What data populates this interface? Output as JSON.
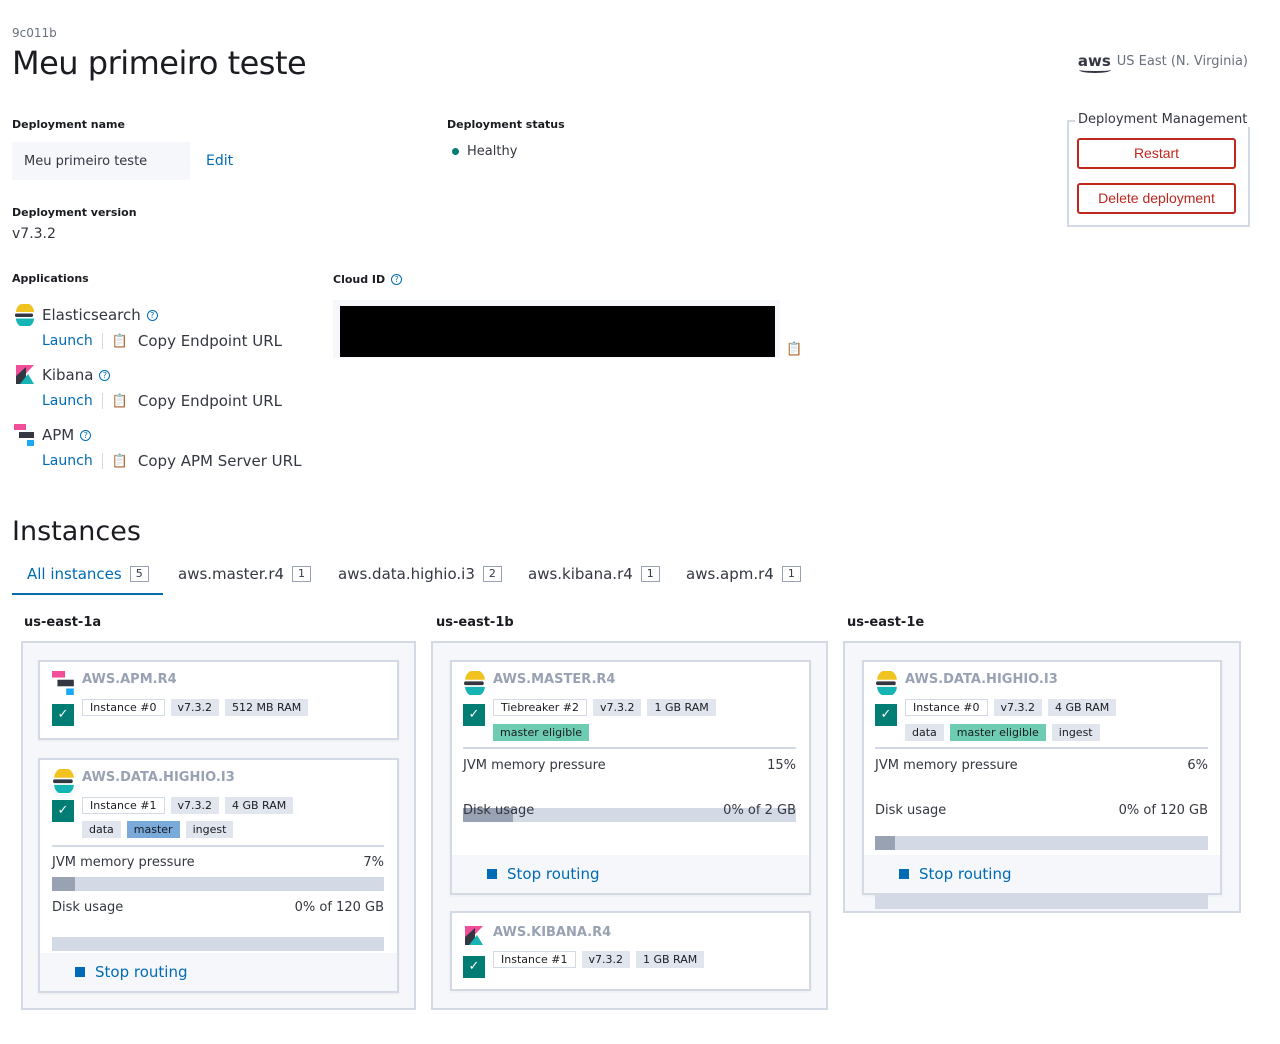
{
  "header": {
    "deployment_id": "9c011b",
    "title": "Meu primeiro teste",
    "region_logo": "aws",
    "region": "US East (N. Virginia)"
  },
  "deployment_name": {
    "label": "Deployment name",
    "value": "Meu primeiro teste",
    "edit": "Edit"
  },
  "deployment_status": {
    "label": "Deployment status",
    "value": "Healthy",
    "color": "#017d73"
  },
  "management": {
    "legend": "Deployment Management",
    "restart": "Restart",
    "delete": "Delete deployment"
  },
  "version": {
    "label": "Deployment version",
    "value": "v7.3.2"
  },
  "applications": {
    "label": "Applications",
    "items": [
      {
        "name": "Elasticsearch",
        "icon": "elasticsearch-icon",
        "launch": "Launch",
        "copy": "Copy Endpoint URL"
      },
      {
        "name": "Kibana",
        "icon": "kibana-icon",
        "launch": "Launch",
        "copy": "Copy Endpoint URL"
      },
      {
        "name": "APM",
        "icon": "apm-icon",
        "launch": "Launch",
        "copy": "Copy APM Server URL"
      }
    ]
  },
  "cloud_id": {
    "label": "Cloud ID",
    "icon": "clipboard-icon"
  },
  "instances": {
    "title": "Instances",
    "tabs": [
      {
        "label": "All instances",
        "count": "5",
        "active": true
      },
      {
        "label": "aws.master.r4",
        "count": "1"
      },
      {
        "label": "aws.data.highio.i3",
        "count": "2"
      },
      {
        "label": "aws.kibana.r4",
        "count": "1"
      },
      {
        "label": "aws.apm.r4",
        "count": "1"
      }
    ]
  },
  "zones": [
    {
      "name": "us-east-1a",
      "cards": [
        {
          "title": "AWS.APM.R4",
          "instance": "Instance #0",
          "version": "v7.3.2",
          "ram": "512 MB RAM"
        },
        {
          "title": "AWS.DATA.HIGHIO.I3",
          "instance": "Instance #1",
          "version": "v7.3.2",
          "ram": "4 GB RAM",
          "roles": [
            "data",
            "master",
            "ingest"
          ],
          "jvm_label": "JVM memory pressure",
          "jvm_value": "7%",
          "jvm_fraction": 0.07,
          "disk_label": "Disk usage",
          "disk_value": "0% of 120 GB",
          "disk_fraction": 0,
          "stop": "Stop routing"
        }
      ]
    },
    {
      "name": "us-east-1b",
      "cards": [
        {
          "title": "AWS.MASTER.R4",
          "instance": "Tiebreaker #2",
          "version": "v7.3.2",
          "ram": "1 GB RAM",
          "roles": [
            "master eligible"
          ],
          "jvm_label": "JVM memory pressure",
          "jvm_value": "15%",
          "jvm_fraction": 0.15,
          "disk_label": "Disk usage",
          "disk_value": "0% of 2 GB",
          "disk_fraction": 0,
          "stop": "Stop routing"
        },
        {
          "title": "AWS.KIBANA.R4",
          "instance": "Instance #1",
          "version": "v7.3.2",
          "ram": "1 GB RAM"
        }
      ]
    },
    {
      "name": "us-east-1e",
      "cards": [
        {
          "title": "AWS.DATA.HIGHIO.I3",
          "instance": "Instance #0",
          "version": "v7.3.2",
          "ram": "4 GB RAM",
          "roles": [
            "data",
            "master eligible",
            "ingest"
          ],
          "jvm_label": "JVM memory pressure",
          "jvm_value": "6%",
          "jvm_fraction": 0.06,
          "disk_label": "Disk usage",
          "disk_value": "0% of 120 GB",
          "disk_fraction": 0,
          "stop": "Stop routing"
        }
      ]
    }
  ]
}
